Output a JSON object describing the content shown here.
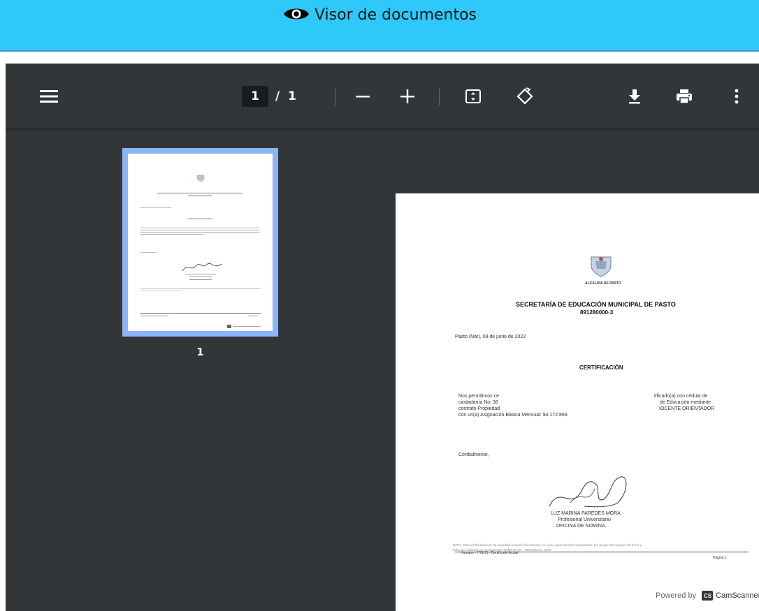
{
  "header": {
    "title": "Visor de documentos",
    "icon": "eye-icon",
    "background": "#2ec8fb"
  },
  "toolbar": {
    "menu_icon": "menu-icon",
    "current_page": "1",
    "page_separator": "/",
    "total_pages": "1",
    "zoom_out_icon": "minus-icon",
    "zoom_in_icon": "plus-icon",
    "fit_icon": "fit-page-icon",
    "rotate_icon": "rotate-icon",
    "download_icon": "download-icon",
    "print_icon": "print-icon",
    "more_icon": "more-vert-icon"
  },
  "sidebar": {
    "thumbnail_page_number": "1"
  },
  "document": {
    "seal_caption": "ALCALDÍA DE PASTO",
    "heading_line1": "SECRETARÍA DE EDUCACIÓN MUNICIPAL DE PASTO",
    "heading_line2": "891280000-3",
    "date_line": "Pasto (Nar), 08 de junio de 2022",
    "section_title": "CERTIFICACIÓN",
    "body_left": [
      "Nos permitimos ce",
      "ciudadanía No. 36",
      "contrato Propiedad",
      "con un(a) Asignación Básica Mensual: $4.172.869."
    ],
    "body_right": [
      "tificado(a) con cédula de",
      "de Educación mediante",
      "IOCENTE ORIENTADOR"
    ],
    "closing": "Cordialmente,",
    "signer_name": "LUZ MARINA PAREDES MORA",
    "signer_title": "Profesional Universitario",
    "signer_office": "OFICINA DE NOMINA.",
    "note_line1": "NOTA: Esta certificación se ha expedido a través del Humano en Línea para trámites funcionarios, por lo que NO requiere de firma y",
    "note_line2": "debe ser validada en los siguientes teléfonos de - 7244326 Ext. 6600",
    "footer_left": "Humano - (790.2) - Certificado Actual",
    "footer_right": "Página 1",
    "powered_by": "Powered by",
    "camscanner": "CamScanner"
  }
}
